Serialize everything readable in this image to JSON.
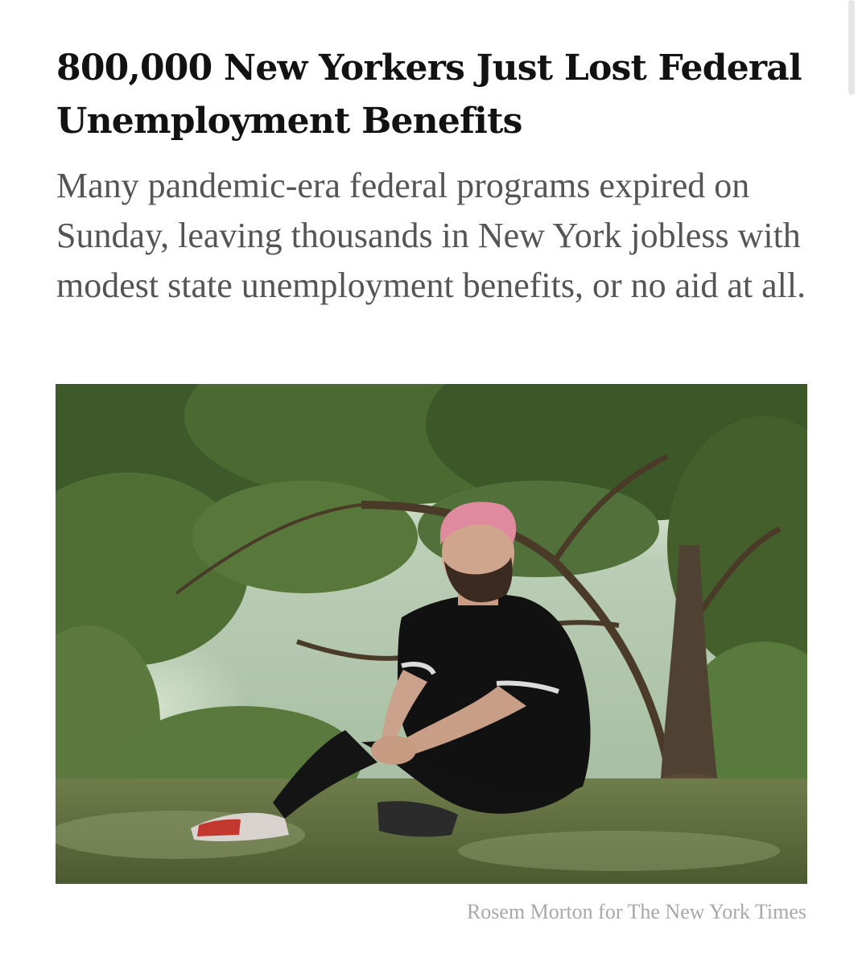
{
  "article": {
    "headline": "800,000 New Yorkers Just Lost Federal Unemployment Benefits",
    "summary": "Many pandemic-era federal programs expired on Sunday, leaving thousands in New York jobless with modest state unemployment benefits, or no aid at all.",
    "photo_credit": "Rosem Morton for The New York Times"
  },
  "colors": {
    "headline": "#121212",
    "summary": "#555555",
    "credit": "#a8a8a8",
    "background": "#ffffff"
  }
}
